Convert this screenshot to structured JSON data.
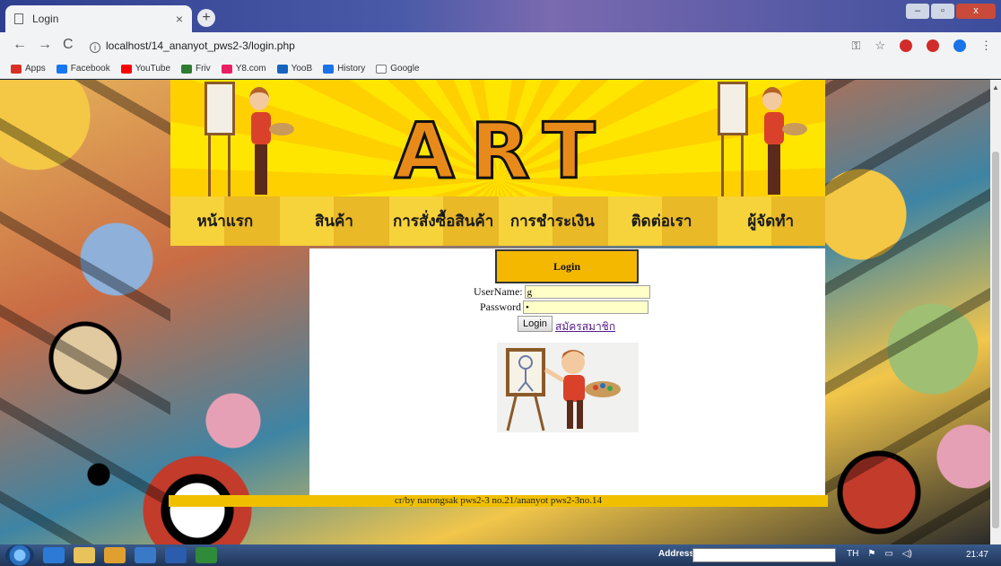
{
  "browser": {
    "tab_title": "Login",
    "tab_close": "×",
    "new_tab": "+",
    "url": "localhost/14_ananyot_pws2-3/login.php",
    "bookmarks": [
      {
        "label": "Apps",
        "color": "#d93025"
      },
      {
        "label": "Facebook",
        "color": "#1877f2"
      },
      {
        "label": "YouTube",
        "color": "#ff0000"
      },
      {
        "label": "Friv",
        "color": "#2e7d32"
      },
      {
        "label": "Y8.com",
        "color": "#e91e63"
      },
      {
        "label": "YooB",
        "color": "#1565c0"
      },
      {
        "label": "History",
        "color": "#1a73e8"
      },
      {
        "label": "Google",
        "color": "#777777"
      }
    ]
  },
  "banner": {
    "title": "ART"
  },
  "menu": [
    {
      "label": "หน้าแรก"
    },
    {
      "label": "สินค้า"
    },
    {
      "label": "การสั่งซื้อสินค้า"
    },
    {
      "label": "การชำระเงิน"
    },
    {
      "label": "ติดต่อเรา"
    },
    {
      "label": "ผู้จัดทำ"
    }
  ],
  "login": {
    "heading": "Login",
    "username_label": "UserName:",
    "username_value": "g",
    "password_label": "Password",
    "password_value": "•",
    "submit_label": "Login",
    "register_label": "สมัครสมาชิก"
  },
  "footer": {
    "text": "cr/by narongsak pws2-3 no.21/ananyot pws2-3no.14"
  },
  "taskbar": {
    "address_label": "Address",
    "language": "TH",
    "time": "21:47"
  },
  "colors": {
    "accent_yellow": "#f5b800",
    "banner_yellow": "#ffe600",
    "art_orange": "#e88a1a"
  }
}
